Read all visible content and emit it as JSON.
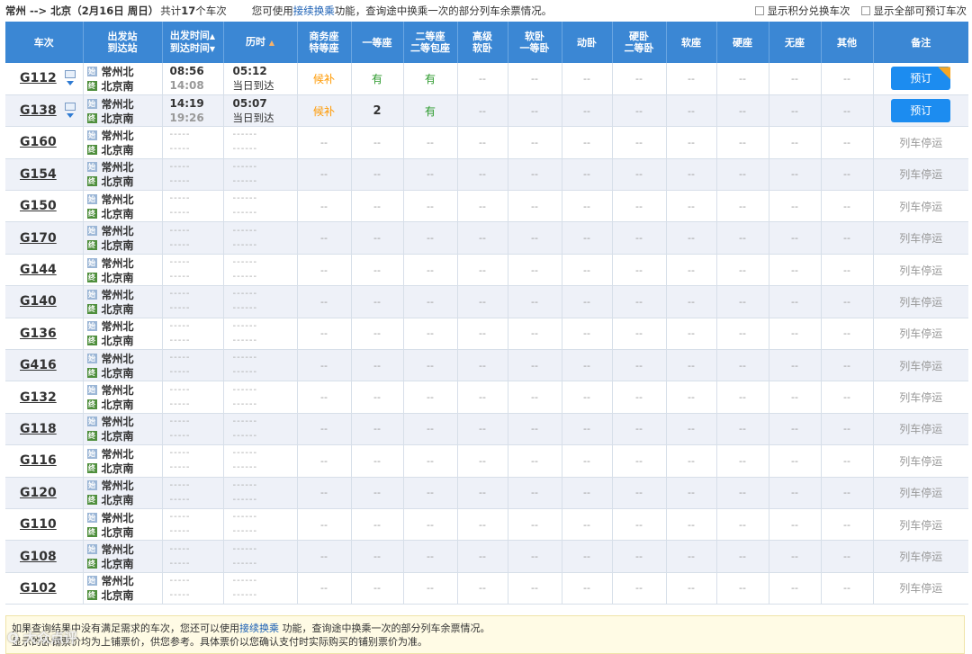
{
  "topbar": {
    "route": "常州 --> 北京（2月16日 周日）",
    "count_prefix": "共计",
    "count": "17",
    "count_suffix": "个车次",
    "hint_prefix": "您可使用",
    "hint_link": "接续换乘",
    "hint_suffix": "功能，查询途中换乘一次的部分列车余票情况。",
    "check1": "显示积分兑换车次",
    "check2": "显示全部可预订车次"
  },
  "headers": {
    "train": "车次",
    "station1": "出发站",
    "station2": "到达站",
    "time1": "出发时间",
    "time2": "到达时间",
    "duration": "历时",
    "swz1": "商务座",
    "swz2": "特等座",
    "ydz": "一等座",
    "edz1": "二等座",
    "edz2": "二等包座",
    "gjrw1": "高级",
    "gjrw2": "软卧",
    "rw1": "软卧",
    "rw2": "一等卧",
    "dw": "动卧",
    "yw1": "硬卧",
    "yw2": "二等卧",
    "rz": "软座",
    "yz": "硬座",
    "wz": "无座",
    "qt": "其他",
    "remark": "备注",
    "sort_up": "▲",
    "sort_down": "▼"
  },
  "labels": {
    "from_station": "常州北",
    "to_station": "北京南",
    "start_badge": "始",
    "end_badge": "终",
    "dash_time": "-----",
    "dash_dur": "------",
    "empty_cell": "--",
    "book": "预订",
    "stopped": "列车停运"
  },
  "trains": [
    {
      "no": "G112",
      "depart": "08:56",
      "arrive": "14:08",
      "duration": "05:12",
      "arrival_day": "当日到达",
      "swz": "候补",
      "ydz": "有",
      "edz": "有",
      "bookable": true,
      "flag": true
    },
    {
      "no": "G138",
      "depart": "14:19",
      "arrive": "19:26",
      "duration": "05:07",
      "arrival_day": "当日到达",
      "swz": "候补",
      "ydz": "2",
      "edz": "有",
      "bookable": true,
      "flag": false
    },
    {
      "no": "G160",
      "bookable": false
    },
    {
      "no": "G154",
      "bookable": false
    },
    {
      "no": "G150",
      "bookable": false
    },
    {
      "no": "G170",
      "bookable": false
    },
    {
      "no": "G144",
      "bookable": false
    },
    {
      "no": "G140",
      "bookable": false
    },
    {
      "no": "G136",
      "bookable": false
    },
    {
      "no": "G416",
      "bookable": false
    },
    {
      "no": "G132",
      "bookable": false
    },
    {
      "no": "G118",
      "bookable": false
    },
    {
      "no": "G116",
      "bookable": false
    },
    {
      "no": "G120",
      "bookable": false
    },
    {
      "no": "G110",
      "bookable": false
    },
    {
      "no": "G108",
      "bookable": false
    },
    {
      "no": "G102",
      "bookable": false
    }
  ],
  "notice": {
    "line1_prefix": "如果查询结果中没有满足需求的车次，您还可以使用",
    "line1_link": "接续换乘",
    "line1_suffix": " 功能，查询途中换乘一次的部分列车余票情况。",
    "line2": "显示的卧铺票价均为上铺票价，供您参考。具体票价以您确认支付时实际购买的铺别票价为准。"
  },
  "watermark": "Q 大众点评"
}
